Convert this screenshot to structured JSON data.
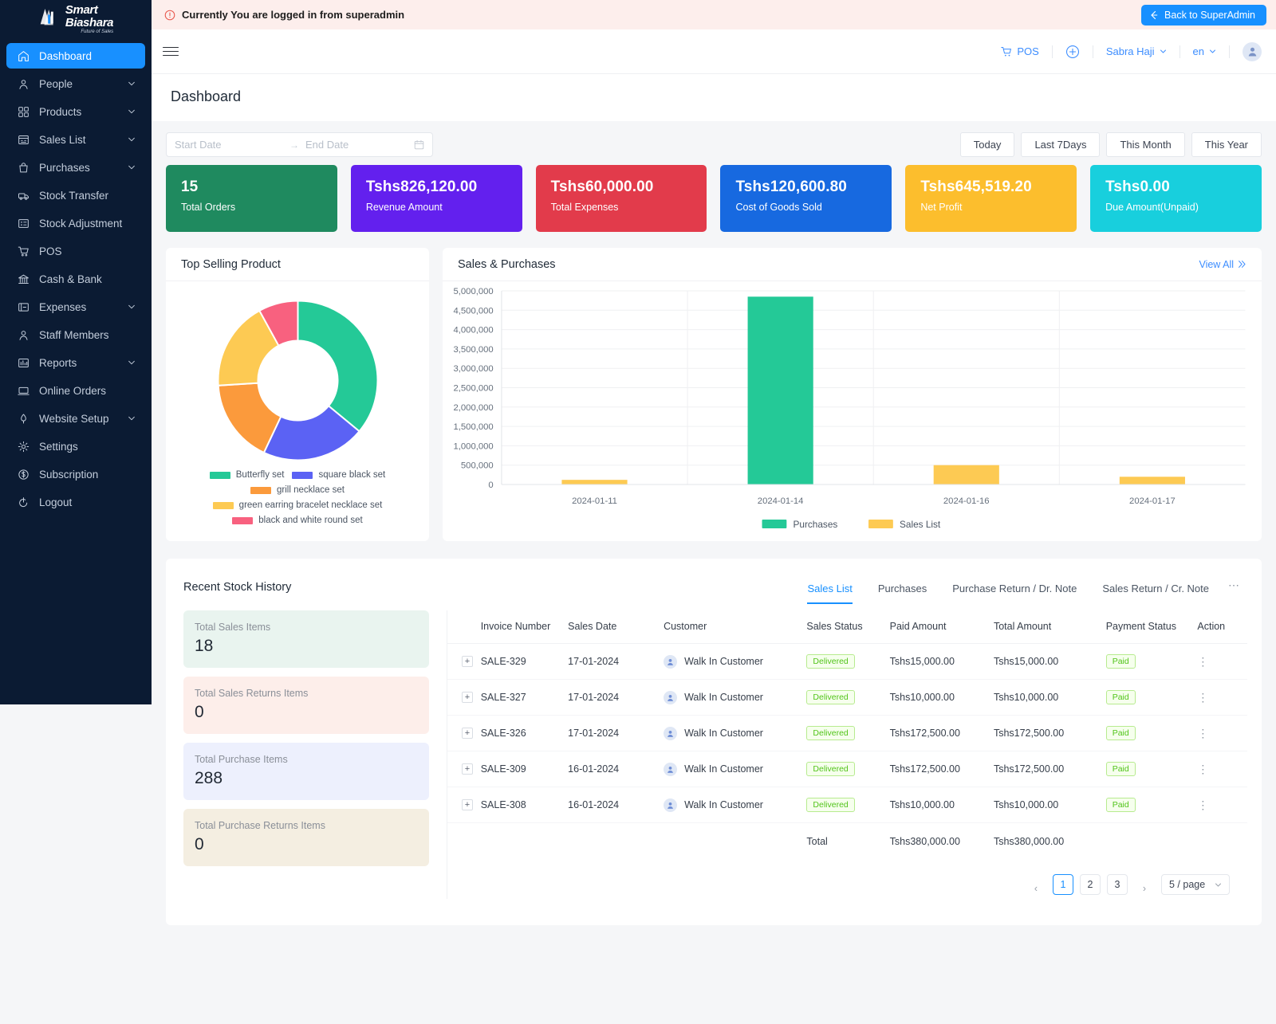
{
  "brand": {
    "line1": "Smart",
    "line2": "Biashara",
    "tagline": "Future of Sales"
  },
  "alert": {
    "text": "Currently You are logged in from superadmin",
    "button": "Back to SuperAdmin"
  },
  "topbar": {
    "pos": "POS",
    "user": "Sabra Haji",
    "lang": "en"
  },
  "page": {
    "title": "Dashboard"
  },
  "sidebar": {
    "items": [
      {
        "label": "Dashboard",
        "icon": "home-icon",
        "active": true,
        "expand": false
      },
      {
        "label": "People",
        "icon": "people-icon",
        "active": false,
        "expand": true
      },
      {
        "label": "Products",
        "icon": "products-icon",
        "active": false,
        "expand": true
      },
      {
        "label": "Sales List",
        "icon": "sales-icon",
        "active": false,
        "expand": true
      },
      {
        "label": "Purchases",
        "icon": "purchases-icon",
        "active": false,
        "expand": true
      },
      {
        "label": "Stock Transfer",
        "icon": "truck-icon",
        "active": false,
        "expand": false
      },
      {
        "label": "Stock Adjustment",
        "icon": "adjustment-icon",
        "active": false,
        "expand": false
      },
      {
        "label": "POS",
        "icon": "cart-icon",
        "active": false,
        "expand": false
      },
      {
        "label": "Cash & Bank",
        "icon": "bank-icon",
        "active": false,
        "expand": false
      },
      {
        "label": "Expenses",
        "icon": "expenses-icon",
        "active": false,
        "expand": true
      },
      {
        "label": "Staff Members",
        "icon": "user-icon",
        "active": false,
        "expand": false
      },
      {
        "label": "Reports",
        "icon": "reports-icon",
        "active": false,
        "expand": true
      },
      {
        "label": "Online Orders",
        "icon": "online-orders-icon",
        "active": false,
        "expand": false
      },
      {
        "label": "Website Setup",
        "icon": "website-icon",
        "active": false,
        "expand": true
      },
      {
        "label": "Settings",
        "icon": "gear-icon",
        "active": false,
        "expand": false
      },
      {
        "label": "Subscription",
        "icon": "subscription-icon",
        "active": false,
        "expand": false
      },
      {
        "label": "Logout",
        "icon": "logout-icon",
        "active": false,
        "expand": false
      }
    ]
  },
  "filters": {
    "start_placeholder": "Start Date",
    "end_placeholder": "End Date",
    "quick": [
      "Today",
      "Last 7Days",
      "This Month",
      "This Year"
    ]
  },
  "stats": [
    {
      "value": "15",
      "label": "Total Orders",
      "color": "#1f8a5f"
    },
    {
      "value": "Tshs826,120.00",
      "label": "Revenue Amount",
      "color": "#6320ee"
    },
    {
      "value": "Tshs60,000.00",
      "label": "Total Expenses",
      "color": "#e23b4b"
    },
    {
      "value": "Tshs120,600.80",
      "label": "Cost of Goods Sold",
      "color": "#1769e0"
    },
    {
      "value": "Tshs645,519.20",
      "label": "Net Profit",
      "color": "#fcbe2d"
    },
    {
      "value": "Tshs0.00",
      "label": "Due Amount(Unpaid)",
      "color": "#18cfdd"
    }
  ],
  "top_selling": {
    "title": "Top Selling Product"
  },
  "sales_purchases": {
    "title": "Sales & Purchases",
    "view_all": "View All"
  },
  "chart_data": [
    {
      "type": "pie",
      "title": "Top Selling Product",
      "legend_position": "bottom",
      "labels": [
        "Butterfly set",
        "square black set",
        "grill necklace set",
        "green earring bracelet necklace set",
        "black and white round set"
      ],
      "values": [
        36,
        21,
        17,
        18,
        8
      ],
      "colors": [
        "#24c997",
        "#5b62f4",
        "#fb9a3c",
        "#fdca53",
        "#f8617f"
      ]
    },
    {
      "type": "bar",
      "title": "Sales & Purchases",
      "categories": [
        "2024-01-11",
        "2024-01-14",
        "2024-01-16",
        "2024-01-17"
      ],
      "series": [
        {
          "name": "Purchases",
          "values": [
            0,
            4850000,
            0,
            0
          ],
          "color": "#24c997"
        },
        {
          "name": "Sales List",
          "values": [
            120000,
            0,
            500000,
            200000
          ],
          "color": "#fdca53"
        }
      ],
      "ylim": [
        0,
        5000000
      ],
      "yticks": [
        "0",
        "500,000",
        "1,000,000",
        "1,500,000",
        "2,000,000",
        "2,500,000",
        "3,000,000",
        "3,500,000",
        "4,000,000",
        "4,500,000",
        "5,000,000"
      ],
      "xlabel": "",
      "ylabel": "",
      "grid": true,
      "legend_position": "bottom"
    }
  ],
  "stock_history": {
    "title": "Recent Stock History",
    "tabs": [
      {
        "label": "Sales List",
        "active": true
      },
      {
        "label": "Purchases",
        "active": false
      },
      {
        "label": "Purchase Return / Dr. Note",
        "active": false
      },
      {
        "label": "Sales Return / Cr. Note",
        "active": false
      }
    ],
    "more": "⋯",
    "minis": [
      {
        "label": "Total Sales Items",
        "value": "18",
        "bg": "#e9f4ef"
      },
      {
        "label": "Total Sales Returns Items",
        "value": "0",
        "bg": "#fdeeea"
      },
      {
        "label": "Total Purchase Items",
        "value": "288",
        "bg": "#edf0fd"
      },
      {
        "label": "Total Purchase Returns Items",
        "value": "0",
        "bg": "#f4eee1"
      }
    ],
    "columns": [
      "",
      "Invoice Number",
      "Sales Date",
      "Customer",
      "Sales Status",
      "Paid Amount",
      "Total Amount",
      "Payment Status",
      "Action"
    ],
    "rows": [
      {
        "invoice": "SALE-329",
        "date": "17-01-2024",
        "customer": "Walk In Customer",
        "status": "Delivered",
        "paid": "Tshs15,000.00",
        "total": "Tshs15,000.00",
        "payment": "Paid"
      },
      {
        "invoice": "SALE-327",
        "date": "17-01-2024",
        "customer": "Walk In Customer",
        "status": "Delivered",
        "paid": "Tshs10,000.00",
        "total": "Tshs10,000.00",
        "payment": "Paid"
      },
      {
        "invoice": "SALE-326",
        "date": "17-01-2024",
        "customer": "Walk In Customer",
        "status": "Delivered",
        "paid": "Tshs172,500.00",
        "total": "Tshs172,500.00",
        "payment": "Paid"
      },
      {
        "invoice": "SALE-309",
        "date": "16-01-2024",
        "customer": "Walk In Customer",
        "status": "Delivered",
        "paid": "Tshs172,500.00",
        "total": "Tshs172,500.00",
        "payment": "Paid"
      },
      {
        "invoice": "SALE-308",
        "date": "16-01-2024",
        "customer": "Walk In Customer",
        "status": "Delivered",
        "paid": "Tshs10,000.00",
        "total": "Tshs10,000.00",
        "payment": "Paid"
      }
    ],
    "totals": {
      "label": "Total",
      "paid": "Tshs380,000.00",
      "total": "Tshs380,000.00"
    },
    "pagination": {
      "prev": "‹",
      "pages": [
        "1",
        "2",
        "3"
      ],
      "next": "›",
      "page_size": "5 / page",
      "current": "1"
    }
  }
}
